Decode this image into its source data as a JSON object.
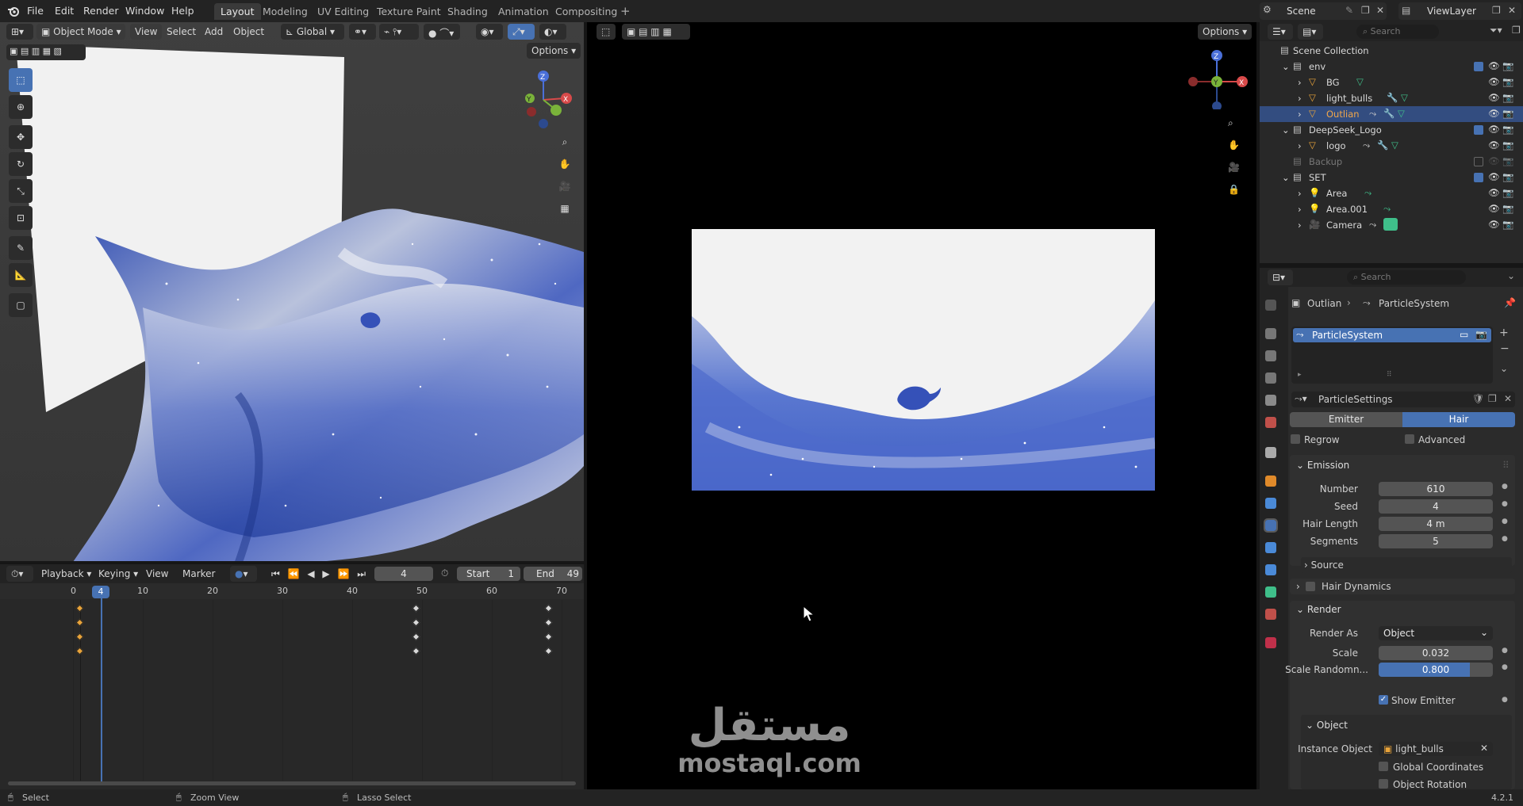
{
  "menu": [
    "File",
    "Edit",
    "Render",
    "Window",
    "Help"
  ],
  "workspaces": [
    "Layout",
    "Modeling",
    "UV Editing",
    "Texture Paint",
    "Shading",
    "Animation",
    "Compositing"
  ],
  "scene": "Scene",
  "view_layer": "ViewLayer",
  "viewport_header": {
    "mode": "Object Mode",
    "menus": [
      "View",
      "Select",
      "Add",
      "Object"
    ],
    "transform": "Global",
    "options": "Options"
  },
  "camera_view": {
    "options": "Options"
  },
  "outliner": {
    "search_placeholder": "Search",
    "rows": [
      {
        "label": "Scene Collection"
      },
      {
        "label": "env"
      },
      {
        "label": "BG"
      },
      {
        "label": "light_bulls"
      },
      {
        "label": "Outlian"
      },
      {
        "label": "DeepSeek_Logo"
      },
      {
        "label": "logo"
      },
      {
        "label": "Backup"
      },
      {
        "label": "SET"
      },
      {
        "label": "Area"
      },
      {
        "label": "Area.001"
      },
      {
        "label": "Camera"
      }
    ]
  },
  "properties": {
    "search_placeholder": "Search",
    "breadcrumb": [
      "Outlian",
      "ParticleSystem"
    ],
    "system_name": "ParticleSystem",
    "settings_name": "ParticleSettings",
    "type_tabs": [
      "Emitter",
      "Hair"
    ],
    "regrow": "Regrow",
    "advanced": "Advanced",
    "emission_header": "Emission",
    "number_label": "Number",
    "number": "610",
    "seed_label": "Seed",
    "seed": "4",
    "hair_length_label": "Hair Length",
    "hair_length": "4 m",
    "segments_label": "Segments",
    "segments": "5",
    "source_header": "Source",
    "hair_dynamics_header": "Hair Dynamics",
    "render_header": "Render",
    "render_as_label": "Render As",
    "render_as": "Object",
    "scale_label": "Scale",
    "scale": "0.032",
    "scale_random_label": "Scale Randomn...",
    "scale_random": "0.800",
    "scale_random_fraction": 0.8,
    "show_emitter": "Show Emitter",
    "object_header": "Object",
    "instance_object_label": "Instance Object",
    "instance_object": "light_bulls",
    "global_coords": "Global Coordinates",
    "object_rotation": "Object Rotation"
  },
  "timeline": {
    "menus": [
      "Playback",
      "Keying",
      "View",
      "Marker"
    ],
    "current_frame": "4",
    "start_label": "Start",
    "start": "1",
    "end_label": "End",
    "end": "49",
    "ticks": [
      "0",
      "10",
      "20",
      "30",
      "40",
      "50",
      "60",
      "70"
    ]
  },
  "watermark": {
    "arabic": "مستقل",
    "latin": "mostaql.com"
  },
  "statusbar": {
    "select": "Select",
    "zoom": "Zoom View",
    "lasso": "Lasso Select",
    "version": "4.2.1"
  },
  "colors": {
    "accent": "#4772b3",
    "selected_row": "#334d80",
    "object_orange": "#e8a33a",
    "cloth_blue": "#2f4fb8"
  }
}
